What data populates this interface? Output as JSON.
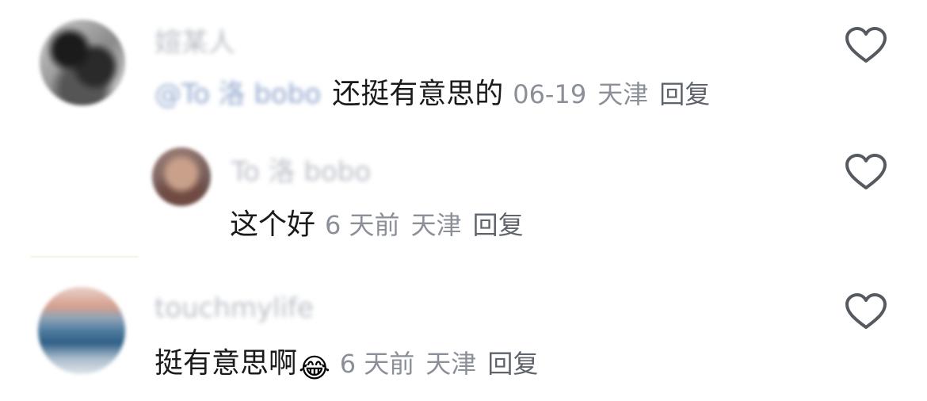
{
  "comments": [
    {
      "username": "媗某人",
      "mention": "@To 洛 bobo",
      "text": "还挺有意思的",
      "date": "06-19",
      "location": "天津",
      "reply_label": "回复"
    },
    {
      "username": "To 洛 bobo",
      "text": "这个好",
      "date": "6 天前",
      "location": "天津",
      "reply_label": "回复"
    },
    {
      "username": "touchmylife",
      "text": "挺有意思啊",
      "emoji": "😂",
      "date": "6 天前",
      "location": "天津",
      "reply_label": "回复"
    }
  ],
  "icons": {
    "like": "heart-outline-icon"
  },
  "colors": {
    "comment_text": "#1a1a1a",
    "meta_text": "#8a8f98",
    "mention_text": "#8fa6cc",
    "heart_stroke": "#555a60"
  }
}
